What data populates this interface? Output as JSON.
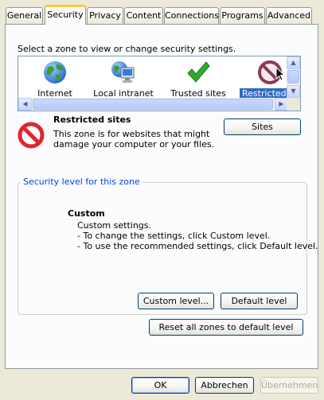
{
  "tabs": [
    {
      "label": "General"
    },
    {
      "label": "Security",
      "active": true
    },
    {
      "label": "Privacy"
    },
    {
      "label": "Content"
    },
    {
      "label": "Connections"
    },
    {
      "label": "Programs"
    },
    {
      "label": "Advanced"
    }
  ],
  "instruction": "Select a zone to view or change security settings.",
  "zones": [
    {
      "label": "Internet",
      "icon": "globe-icon"
    },
    {
      "label": "Local intranet",
      "icon": "intranet-icon"
    },
    {
      "label": "Trusted sites",
      "icon": "checkmark-icon"
    },
    {
      "label": "Restricted s",
      "icon": "restricted-icon",
      "selected": true
    }
  ],
  "zone_detail": {
    "title": "Restricted sites",
    "description_line1": "This zone is for websites that might",
    "description_line2": "damage your computer or your files.",
    "sites_button": "Sites"
  },
  "security_level": {
    "legend": "Security level for this zone",
    "heading": "Custom",
    "line1": "Custom settings.",
    "line2": "- To change the settings, click Custom level.",
    "line3": "- To use the recommended settings, click Default level.",
    "custom_button": "Custom level...",
    "default_button": "Default level"
  },
  "reset_button": "Reset all zones to default level",
  "footer": {
    "ok": "OK",
    "cancel": "Abbrechen",
    "apply": "Übernehmen"
  },
  "colors": {
    "selection": "#316ac5",
    "group_legend": "#0046d5",
    "restricted_red": "#e0262c"
  }
}
